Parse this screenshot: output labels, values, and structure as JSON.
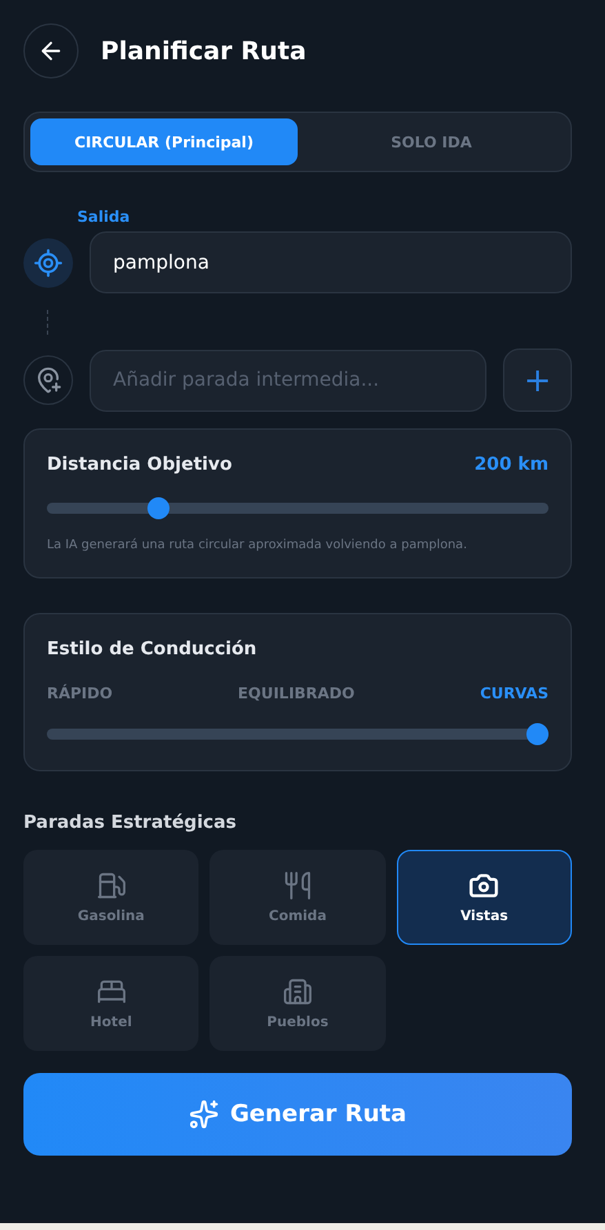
{
  "header": {
    "title": "Planificar Ruta"
  },
  "route_modes": [
    {
      "label": "CIRCULAR (Principal)",
      "selected": true
    },
    {
      "label": "SOLO IDA",
      "selected": false
    }
  ],
  "origin": {
    "label": "Salida",
    "value": "pamplona"
  },
  "waypoint": {
    "placeholder": "Añadir parada intermedia...",
    "add_label": "+"
  },
  "distance": {
    "title": "Distancia Objetivo",
    "reading": "200 km",
    "level": 0.21,
    "note": "La IA generará una ruta circular aproximada volviendo a pamplona."
  },
  "driving_style": {
    "title": "Estilo de Conducción",
    "options": [
      {
        "label": "RÁPIDO",
        "selected": false
      },
      {
        "label": "EQUILIBRADO",
        "selected": false
      },
      {
        "label": "CURVAS",
        "selected": true
      }
    ],
    "level": 1
  },
  "stops": {
    "title": "Paradas Estratégicas",
    "items": [
      {
        "kind": "fuel",
        "label": "Gasolina",
        "selected": false
      },
      {
        "kind": "food",
        "label": "Comida",
        "selected": false
      },
      {
        "kind": "camera",
        "label": "Vistas",
        "selected": true
      },
      {
        "kind": "bed",
        "label": "Hotel",
        "selected": false
      },
      {
        "kind": "town",
        "label": "Pueblos",
        "selected": false
      }
    ]
  },
  "generate_button": {
    "label": "Generar Ruta"
  }
}
